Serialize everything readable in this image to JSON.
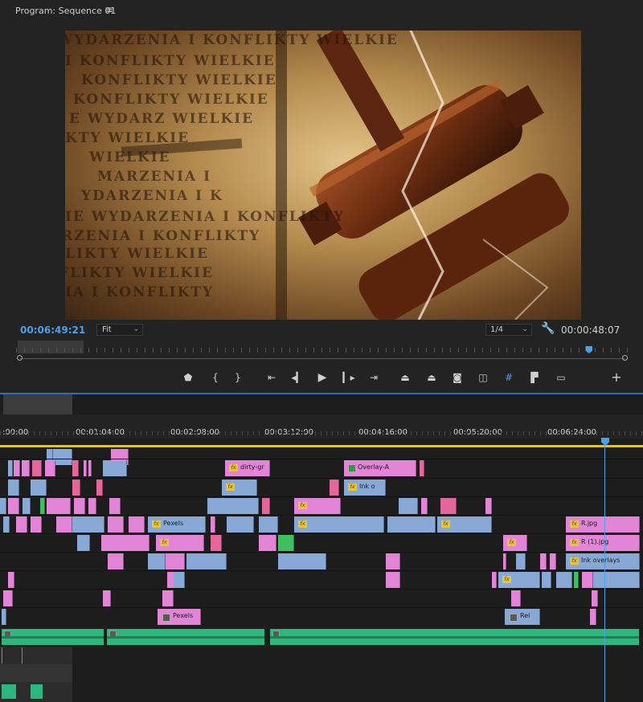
{
  "monitor": {
    "title": "Program: Sequence 01",
    "menu_icon": "hamburger-icon",
    "video_text_lines": [
      "WYDARZENIA I KONFLIKTY WIELKIE",
      "I KONFLIKTY WIELKIE",
      "KONFLIKTY WIELKIE",
      "KONFLIKTY WIELKIE",
      "E WYDARZ WIELKIE",
      "KTY WIELKIE",
      "WIELKIE",
      "MARZENIA I",
      "YDARZENIA I K",
      "IE WYDARZENIA I KONFLIKTY",
      "RZENIA I KONFLIKTY",
      "LIKTY WIELKIE",
      "FLIKTY WIELKIE",
      "IA I KONFLIKTY"
    ],
    "current_timecode": "00:06:49:21",
    "fit_label": "Fit",
    "resolution_label": "1/4",
    "duration_timecode": "00:00:48:07",
    "playhead_fraction": 0.935,
    "settings_icon": "wrench-icon"
  },
  "transport": [
    {
      "name": "add-marker-button",
      "glyph": "⬟"
    },
    {
      "name": "mark-in-button",
      "glyph": "{"
    },
    {
      "name": "mark-out-button",
      "glyph": "}"
    },
    {
      "name": "go-to-in-button",
      "glyph": "⇤"
    },
    {
      "name": "step-back-button",
      "glyph": "◂▎"
    },
    {
      "name": "play-button",
      "glyph": "▶"
    },
    {
      "name": "step-forward-button",
      "glyph": "▎▸"
    },
    {
      "name": "go-to-out-button",
      "glyph": "⇥"
    },
    {
      "name": "lift-button",
      "glyph": "⏏"
    },
    {
      "name": "extract-button",
      "glyph": "⏏"
    },
    {
      "name": "export-frame-button",
      "glyph": "◙"
    },
    {
      "name": "comparison-view-button",
      "glyph": "◫"
    },
    {
      "name": "safe-margins-button",
      "glyph": "#"
    },
    {
      "name": "proxy-toggle-button",
      "glyph": "▛"
    },
    {
      "name": "vr-video-button",
      "glyph": "▭"
    },
    {
      "name": "button-editor-button",
      "glyph": "+"
    }
  ],
  "timeline": {
    "ruler_labels": [
      ":00:00",
      "00:01:04:00",
      "00:02:08:00",
      "00:03:12:00",
      "00:04:16:00",
      "00:05:20:00",
      "00:06:24:00"
    ],
    "clip_labels": {
      "dirty": "dirty-gr",
      "overlay": "Overlay-A",
      "ink_short": "Ink o",
      "pexels_1": "Pexels",
      "rjpg": "R.jpg",
      "r1jpg": "R (1).jpg",
      "ink_overlays": "Ink overlays",
      "pexels_2": "Pexels",
      "rel": "Rel"
    },
    "colors": {
      "pink": "#e285d7",
      "blue": "#88a8d6",
      "rose": "#e4679b",
      "green": "#3fbf5f",
      "audio": "#2fb57e",
      "playhead": "#4f9ee8",
      "work_area_bar": "#d9c53a"
    }
  }
}
